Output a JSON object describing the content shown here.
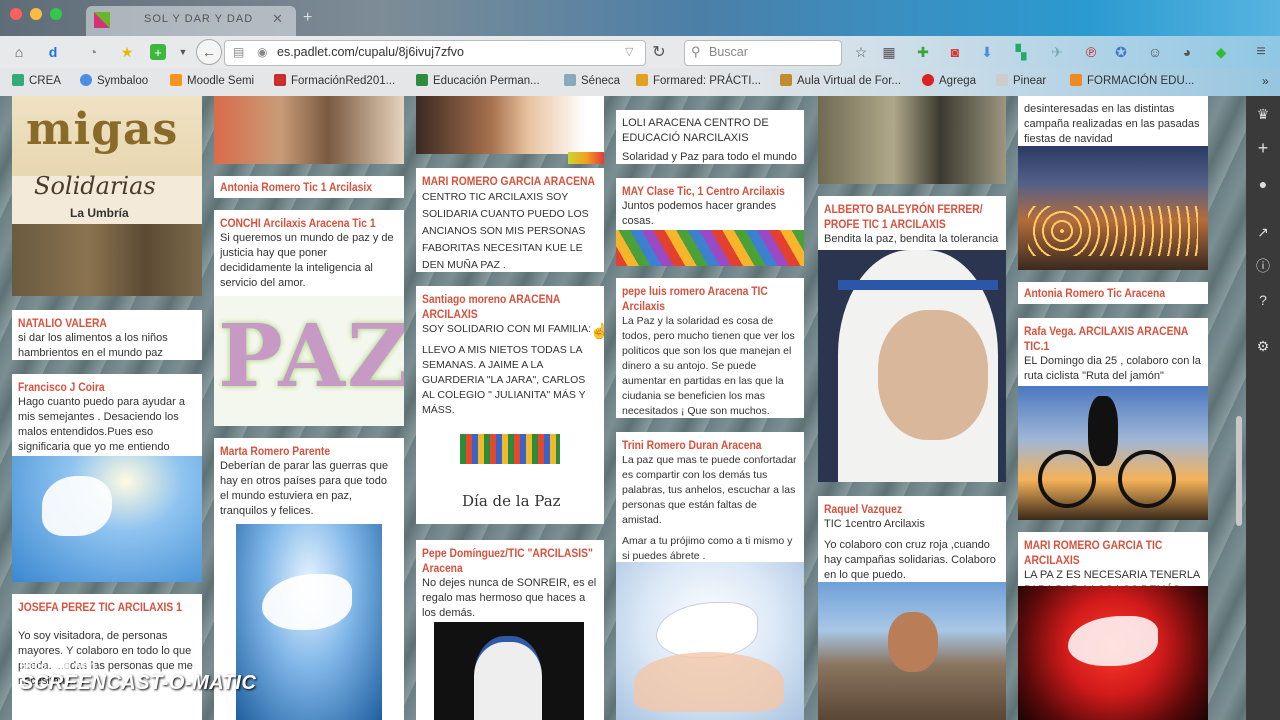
{
  "browser": {
    "tab_title": "SOL Y DAR Y DAD",
    "url": "es.padlet.com/cupalu/8j6ivuj7zfvo",
    "search_placeholder": "Buscar",
    "bookmarks": [
      "CREA",
      "Symbaloo",
      "Moodle Semi",
      "FormaciónRed201...",
      "Educación Perman...",
      "Séneca",
      "Formared: PRÁCTI...",
      "Aula Virtual de For...",
      "Agrega",
      "Pinear",
      "FORMACIÓN EDU..."
    ]
  },
  "cards": {
    "c1": {
      "poster_line1": "migas",
      "poster_line2": "Solidarias",
      "poster_line3": "La Umbría"
    },
    "c2": {
      "title": "NATALIO VALERA",
      "body": "si dar los alimentos a los niños hambrientos en el mundo paz"
    },
    "c3": {
      "title": "Francisco J Coira",
      "body": "Hago cuanto puedo para ayudar a mis semejantes . Desaciendo los malos entendidos.Pues eso significaria que yo me entiendo"
    },
    "c4": {
      "title": "JOSEFA PEREZ TIC ARCILAXIS 1",
      "body": "Yo soy visitadora, de personas mayores. Y colaboro en todo lo que pueda. ...odas las personas que me necesitan ..."
    },
    "c5": {
      "title": "Antonia Romero Tic 1 Arcilasix"
    },
    "c6": {
      "title": "CONCHI      Arcilaxis Aracena Tic 1",
      "body": "Si queremos un mundo de paz y de justicia hay que poner decididamente la inteligencia al servicio del amor.",
      "paz_word": "PAZ"
    },
    "c7": {
      "title": "Marta Romero Parente",
      "body": "Deberían de parar las guerras que hay en otros países para que todo el mundo estuviera en paz, tranquilos y felices."
    },
    "c8": {
      "title": "MARI ROMERO GARCIA ARACENA",
      "body": "CENTRO TIC ARCILAXIS SOY SOLIDARIA CUANTO PUEDO LOS ANCIANOS SON MIS PERSONAS FABORITAS NECESITAN KUE LE DEN MUÑA PAZ ."
    },
    "c9": {
      "title": "Santiago moreno ARACENA ARCILAXIS",
      "body1": "SOY SOLIDARIO CON MI FAMILIA:",
      "body2": "LLEVO A MIS NIETOS TODAS LA SEMANAS. A JAIME A LA GUARDERIA \"LA JARA\", CARLOS AL COLEGIO \" JULIANITA\" MÁS Y MÁSS.",
      "image_caption": "Día de la Paz"
    },
    "c10": {
      "title": "Pepe Domínguez/TIC \"ARCILASIS\" Aracena",
      "body": "No dejes nunca de SONREIR, es el regalo mas hermoso que haces a los demás."
    },
    "c11": {
      "body1": "LOLI ARACENA CENTRO DE EDUCACIÓ NARCILAXIS",
      "body2": "Solaridad y Paz para todo el mundo"
    },
    "c12": {
      "title": "MAY  Clase Tic, 1 Centro Arcilaxis",
      "body": "Juntos podemos hacer grandes cosas."
    },
    "c13": {
      "title": "pepe luis romero  Aracena TIC Arcilaxis",
      "body": "La Paz y la solaridad es cosa de todos, pero mucho  tienen que ver los politicos que son los que manejan el dinero a su antojo. Se puede aumentar en partidas en las que la ciudania se beneficien los mas necesitados ¡ Que son muchos."
    },
    "c14": {
      "title": "Trini Romero Duran Aracena",
      "body1": "La paz que mas te puede confortadar es compartir con los demás tus palabras, tus anhelos, escuchar a las personas que están faltas de amistad.",
      "body2": "Amar a tu prójimo como a ti mismo y si puedes ábrete ."
    },
    "c15": {
      "title": "ALBERTO BALEYRÓN FERRER/ PROFE TIC 1 ARCILAXIS",
      "body": "Bendita la paz, bendita la tolerancia"
    },
    "c16": {
      "title": "Raquel Vazquez",
      "body1": "TIC 1centro Arcilaxis",
      "body2": "Yo colaboro con cruz roja ,cuando hay campañas solidarias. Colaboro en lo que puedo."
    },
    "c17": {
      "body": "desinteresadas en las distintas campaña realizadas en las pasadas fiestas de navidad"
    },
    "c18": {
      "title": "Antonia Romero  Tic  Aracena"
    },
    "c19": {
      "title": "Rafa Vega. ARCILAXIS ARACENA TIC.1",
      "body": "EL Domingo dia 25 , colaboro con la ruta ciclista \"Ruta  del jamón\" haciendo fotografias."
    },
    "c20": {
      "title": "MARI ROMERO GARCIA TIC ARCILAXIS",
      "body": "LA PA Z ES NECESARIA TENERLA PARA  DAR A LOS LOS DEMÁS"
    }
  },
  "watermark": {
    "line1": "Recorded with",
    "line2": "SCREENCAST-O-MATIC"
  }
}
